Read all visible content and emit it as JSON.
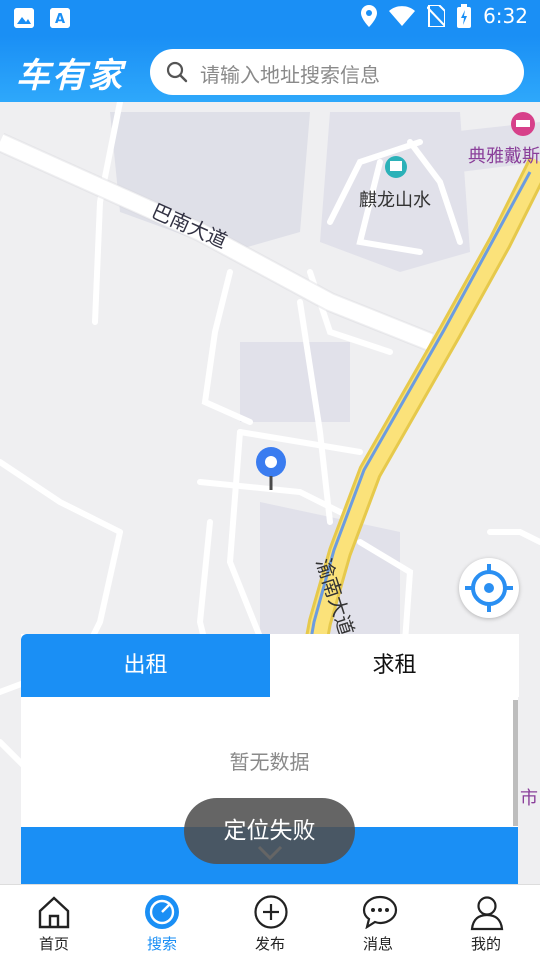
{
  "status_bar": {
    "time": "6:32"
  },
  "header": {
    "brand": "车有家",
    "search_placeholder": "请输入地址搜索信息"
  },
  "map": {
    "labels": [
      "巴南大道",
      "麒龙山水",
      "典雅戴斯",
      "渝南大道",
      "市"
    ]
  },
  "panel": {
    "tabs": [
      "出租",
      "求租"
    ],
    "empty_text": "暂无数据"
  },
  "toast": "定位失败",
  "bottom_nav": [
    "首页",
    "搜索",
    "发布",
    "消息",
    "我的"
  ]
}
